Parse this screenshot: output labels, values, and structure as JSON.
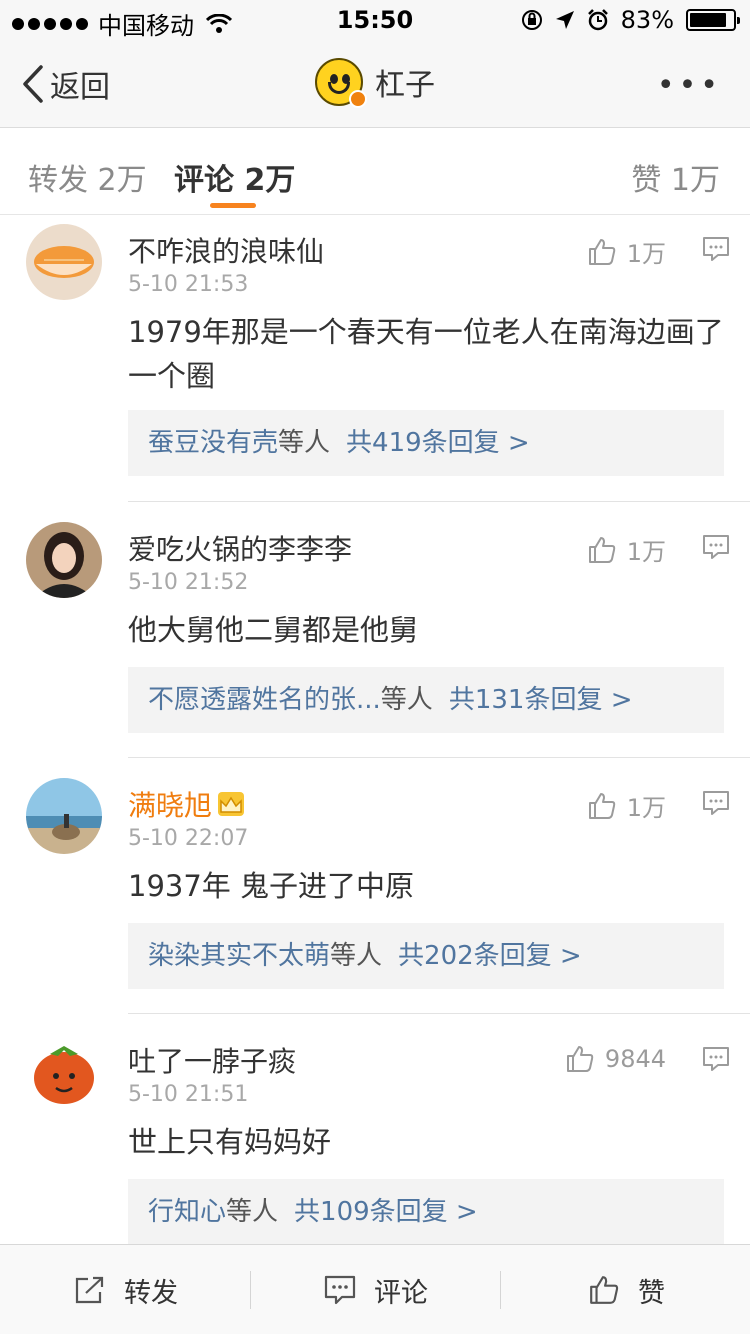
{
  "status_bar": {
    "carrier": "中国移动",
    "time": "15:50",
    "battery": "83%"
  },
  "nav": {
    "back_label": "返回",
    "title": "杠子",
    "more": "•••"
  },
  "tabs": {
    "repost": "转发 2万",
    "comment": "评论 2万",
    "like": "赞 1万"
  },
  "comments": [
    {
      "name": "不咋浪的浪味仙",
      "time": "5-10 21:53",
      "likes": "1万",
      "text": "1979年那是一个春天有一位老人在南海边画了一个圈",
      "reply_users": "蚕豆没有壳",
      "reply_suffix": "等人",
      "reply_count": "共419条回复 >"
    },
    {
      "name": "爱吃火锅的李李李",
      "time": "5-10 21:52",
      "likes": "1万",
      "text": "他大舅他二舅都是他舅",
      "reply_users": "不愿透露姓名的张...",
      "reply_suffix": "等人",
      "reply_count": "共131条回复 >"
    },
    {
      "name": "满晓旭",
      "time": "5-10 22:07",
      "likes": "1万",
      "text": "1937年 鬼子进了中原",
      "reply_users": "染染其实不太萌",
      "reply_suffix": "等人",
      "reply_count": "共202条回复 >"
    },
    {
      "name": "吐了一脖子痰",
      "time": "5-10 21:51",
      "likes": "9844",
      "text": "世上只有妈妈好",
      "reply_users": "行知心",
      "reply_suffix": "等人",
      "reply_count": "共109条回复 >"
    }
  ],
  "toolbar": {
    "repost": "转发",
    "comment": "评论",
    "like": "赞"
  }
}
